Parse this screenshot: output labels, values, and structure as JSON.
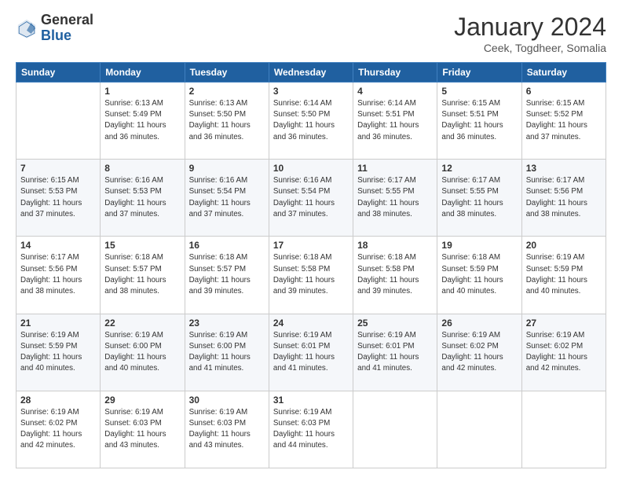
{
  "logo": {
    "general": "General",
    "blue": "Blue"
  },
  "header": {
    "title": "January 2024",
    "subtitle": "Ceek, Togdheer, Somalia"
  },
  "days_of_week": [
    "Sunday",
    "Monday",
    "Tuesday",
    "Wednesday",
    "Thursday",
    "Friday",
    "Saturday"
  ],
  "weeks": [
    [
      {
        "day": "",
        "sunrise": "",
        "sunset": "",
        "daylight": ""
      },
      {
        "day": "1",
        "sunrise": "Sunrise: 6:13 AM",
        "sunset": "Sunset: 5:49 PM",
        "daylight": "Daylight: 11 hours and 36 minutes."
      },
      {
        "day": "2",
        "sunrise": "Sunrise: 6:13 AM",
        "sunset": "Sunset: 5:50 PM",
        "daylight": "Daylight: 11 hours and 36 minutes."
      },
      {
        "day": "3",
        "sunrise": "Sunrise: 6:14 AM",
        "sunset": "Sunset: 5:50 PM",
        "daylight": "Daylight: 11 hours and 36 minutes."
      },
      {
        "day": "4",
        "sunrise": "Sunrise: 6:14 AM",
        "sunset": "Sunset: 5:51 PM",
        "daylight": "Daylight: 11 hours and 36 minutes."
      },
      {
        "day": "5",
        "sunrise": "Sunrise: 6:15 AM",
        "sunset": "Sunset: 5:51 PM",
        "daylight": "Daylight: 11 hours and 36 minutes."
      },
      {
        "day": "6",
        "sunrise": "Sunrise: 6:15 AM",
        "sunset": "Sunset: 5:52 PM",
        "daylight": "Daylight: 11 hours and 37 minutes."
      }
    ],
    [
      {
        "day": "7",
        "sunrise": "Sunrise: 6:15 AM",
        "sunset": "Sunset: 5:53 PM",
        "daylight": "Daylight: 11 hours and 37 minutes."
      },
      {
        "day": "8",
        "sunrise": "Sunrise: 6:16 AM",
        "sunset": "Sunset: 5:53 PM",
        "daylight": "Daylight: 11 hours and 37 minutes."
      },
      {
        "day": "9",
        "sunrise": "Sunrise: 6:16 AM",
        "sunset": "Sunset: 5:54 PM",
        "daylight": "Daylight: 11 hours and 37 minutes."
      },
      {
        "day": "10",
        "sunrise": "Sunrise: 6:16 AM",
        "sunset": "Sunset: 5:54 PM",
        "daylight": "Daylight: 11 hours and 37 minutes."
      },
      {
        "day": "11",
        "sunrise": "Sunrise: 6:17 AM",
        "sunset": "Sunset: 5:55 PM",
        "daylight": "Daylight: 11 hours and 38 minutes."
      },
      {
        "day": "12",
        "sunrise": "Sunrise: 6:17 AM",
        "sunset": "Sunset: 5:55 PM",
        "daylight": "Daylight: 11 hours and 38 minutes."
      },
      {
        "day": "13",
        "sunrise": "Sunrise: 6:17 AM",
        "sunset": "Sunset: 5:56 PM",
        "daylight": "Daylight: 11 hours and 38 minutes."
      }
    ],
    [
      {
        "day": "14",
        "sunrise": "Sunrise: 6:17 AM",
        "sunset": "Sunset: 5:56 PM",
        "daylight": "Daylight: 11 hours and 38 minutes."
      },
      {
        "day": "15",
        "sunrise": "Sunrise: 6:18 AM",
        "sunset": "Sunset: 5:57 PM",
        "daylight": "Daylight: 11 hours and 38 minutes."
      },
      {
        "day": "16",
        "sunrise": "Sunrise: 6:18 AM",
        "sunset": "Sunset: 5:57 PM",
        "daylight": "Daylight: 11 hours and 39 minutes."
      },
      {
        "day": "17",
        "sunrise": "Sunrise: 6:18 AM",
        "sunset": "Sunset: 5:58 PM",
        "daylight": "Daylight: 11 hours and 39 minutes."
      },
      {
        "day": "18",
        "sunrise": "Sunrise: 6:18 AM",
        "sunset": "Sunset: 5:58 PM",
        "daylight": "Daylight: 11 hours and 39 minutes."
      },
      {
        "day": "19",
        "sunrise": "Sunrise: 6:18 AM",
        "sunset": "Sunset: 5:59 PM",
        "daylight": "Daylight: 11 hours and 40 minutes."
      },
      {
        "day": "20",
        "sunrise": "Sunrise: 6:19 AM",
        "sunset": "Sunset: 5:59 PM",
        "daylight": "Daylight: 11 hours and 40 minutes."
      }
    ],
    [
      {
        "day": "21",
        "sunrise": "Sunrise: 6:19 AM",
        "sunset": "Sunset: 5:59 PM",
        "daylight": "Daylight: 11 hours and 40 minutes."
      },
      {
        "day": "22",
        "sunrise": "Sunrise: 6:19 AM",
        "sunset": "Sunset: 6:00 PM",
        "daylight": "Daylight: 11 hours and 40 minutes."
      },
      {
        "day": "23",
        "sunrise": "Sunrise: 6:19 AM",
        "sunset": "Sunset: 6:00 PM",
        "daylight": "Daylight: 11 hours and 41 minutes."
      },
      {
        "day": "24",
        "sunrise": "Sunrise: 6:19 AM",
        "sunset": "Sunset: 6:01 PM",
        "daylight": "Daylight: 11 hours and 41 minutes."
      },
      {
        "day": "25",
        "sunrise": "Sunrise: 6:19 AM",
        "sunset": "Sunset: 6:01 PM",
        "daylight": "Daylight: 11 hours and 41 minutes."
      },
      {
        "day": "26",
        "sunrise": "Sunrise: 6:19 AM",
        "sunset": "Sunset: 6:02 PM",
        "daylight": "Daylight: 11 hours and 42 minutes."
      },
      {
        "day": "27",
        "sunrise": "Sunrise: 6:19 AM",
        "sunset": "Sunset: 6:02 PM",
        "daylight": "Daylight: 11 hours and 42 minutes."
      }
    ],
    [
      {
        "day": "28",
        "sunrise": "Sunrise: 6:19 AM",
        "sunset": "Sunset: 6:02 PM",
        "daylight": "Daylight: 11 hours and 42 minutes."
      },
      {
        "day": "29",
        "sunrise": "Sunrise: 6:19 AM",
        "sunset": "Sunset: 6:03 PM",
        "daylight": "Daylight: 11 hours and 43 minutes."
      },
      {
        "day": "30",
        "sunrise": "Sunrise: 6:19 AM",
        "sunset": "Sunset: 6:03 PM",
        "daylight": "Daylight: 11 hours and 43 minutes."
      },
      {
        "day": "31",
        "sunrise": "Sunrise: 6:19 AM",
        "sunset": "Sunset: 6:03 PM",
        "daylight": "Daylight: 11 hours and 44 minutes."
      },
      {
        "day": "",
        "sunrise": "",
        "sunset": "",
        "daylight": ""
      },
      {
        "day": "",
        "sunrise": "",
        "sunset": "",
        "daylight": ""
      },
      {
        "day": "",
        "sunrise": "",
        "sunset": "",
        "daylight": ""
      }
    ]
  ]
}
